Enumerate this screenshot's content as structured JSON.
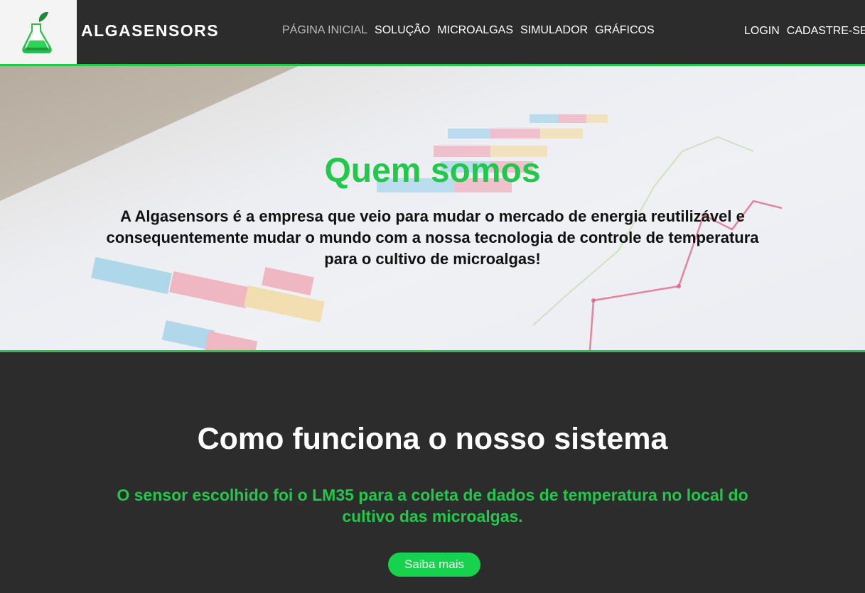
{
  "header": {
    "brand": "ALGASENSORS",
    "logo_icon": "flask-leaf-icon",
    "nav": [
      {
        "label": "PÁGINA INICIAL",
        "active": true
      },
      {
        "label": "SOLUÇÃO"
      },
      {
        "label": "MICROALGAS"
      },
      {
        "label": "SIMULADOR"
      },
      {
        "label": "GRÁFICOS"
      }
    ],
    "auth": {
      "login": "LOGIN",
      "signup": "CADASTRE-SE"
    }
  },
  "hero": {
    "title": "Quem somos",
    "text": "A Algasensors é a empresa que veio para mudar o mercado de energia reutilizável e consequentemente mudar o mundo com a nossa tecnologia de controle de temperatura para o cultivo de microalgas!"
  },
  "section": {
    "title": "Como funciona o nosso sistema",
    "text": "O sensor escolhido foi o LM35 para a coleta de dados de temperatura no local do cultivo das microalgas.",
    "button": "Saiba mais"
  },
  "colors": {
    "accent": "#22c84a",
    "header_bg": "#2c2c2c",
    "button_bg": "#16d24c"
  }
}
